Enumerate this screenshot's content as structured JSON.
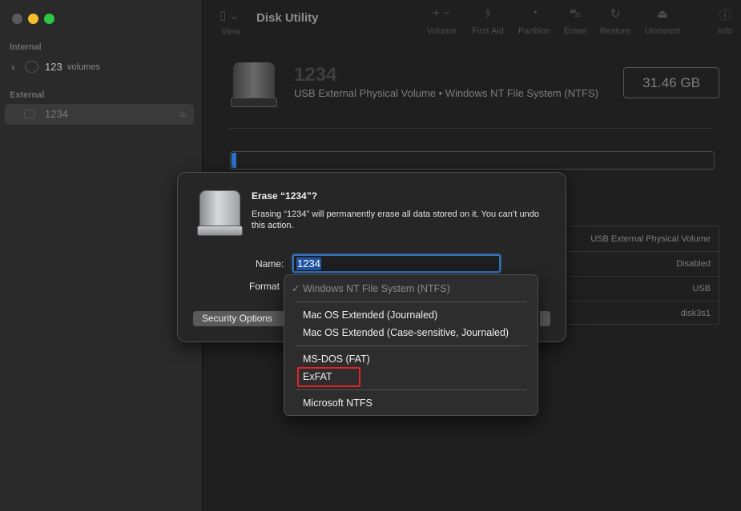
{
  "sidebar": {
    "sections": [
      {
        "header": "Internal",
        "items": [
          {
            "label": "123",
            "sub": "volumes",
            "icon": "disk-icon"
          }
        ]
      },
      {
        "header": "External",
        "items": [
          {
            "label": "1234",
            "icon": "external-drive-icon"
          }
        ]
      }
    ]
  },
  "toolbar": {
    "title": "Disk Utility",
    "view_label": "View",
    "buttons": [
      {
        "label": "Volume",
        "icon": "plus-minus-icon"
      },
      {
        "label": "First Aid",
        "icon": "stethoscope-icon"
      },
      {
        "label": "Partition",
        "icon": "pie-icon"
      },
      {
        "label": "Erase",
        "icon": "erase-icon"
      },
      {
        "label": "Restore",
        "icon": "restore-icon"
      },
      {
        "label": "Unmount",
        "icon": "eject-icon"
      },
      {
        "label": "Info",
        "icon": "info-icon"
      }
    ]
  },
  "volume": {
    "name": "1234",
    "description": "USB External Physical Volume • Windows NT File System (NTFS)",
    "size": "31.46 GB",
    "info_rows": [
      "USB External Physical Volume",
      "Disabled",
      "USB",
      "disk3s1"
    ]
  },
  "erase_sheet": {
    "title": "Erase “1234”?",
    "message": "Erasing “1234” will permanently erase all data stored on it. You can’t undo this action.",
    "name_label": "Name:",
    "name_value": "1234",
    "format_label": "Format",
    "security_button": "Security Options"
  },
  "format_menu": {
    "checked": "✓ Windows NT File System (NTFS)",
    "groups": [
      [
        "Mac OS Extended (Journaled)",
        "Mac OS Extended (Case-sensitive, Journaled)"
      ],
      [
        "MS-DOS (FAT)",
        "ExFAT"
      ],
      [
        "Microsoft NTFS"
      ]
    ],
    "highlight_color": "#e0242a"
  }
}
